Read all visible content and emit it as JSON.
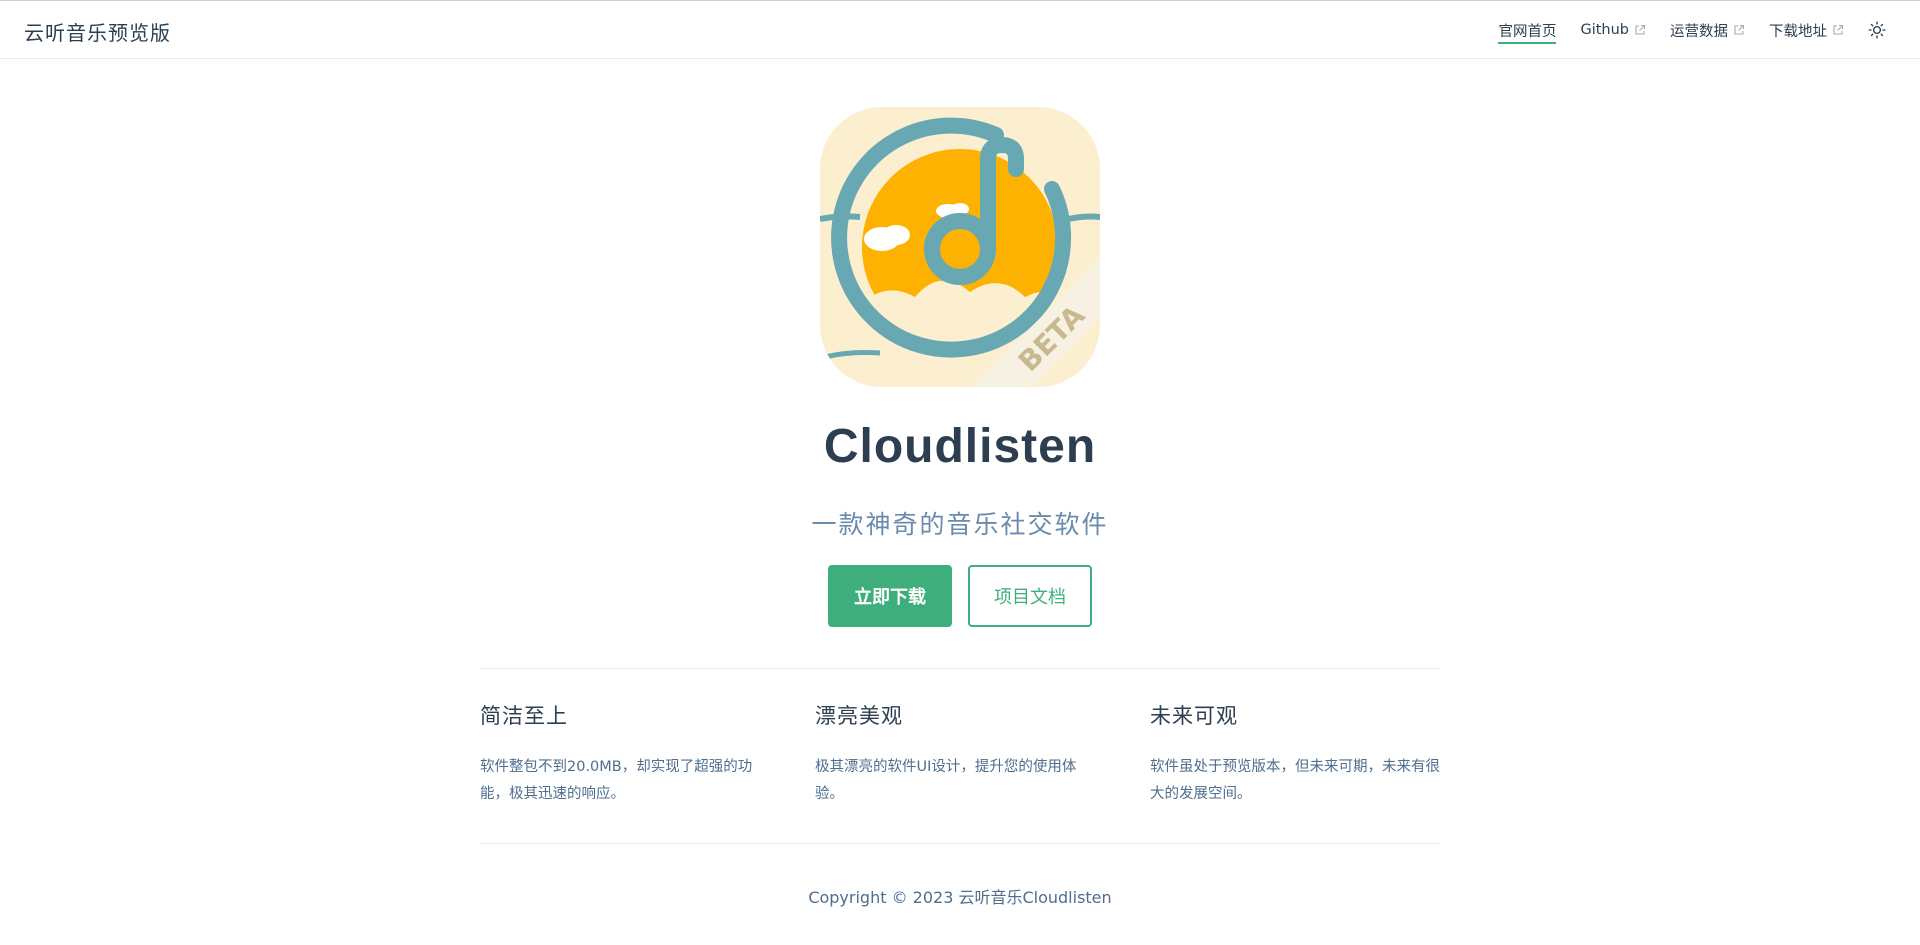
{
  "navbar": {
    "brand": "云听音乐预览版",
    "links": [
      {
        "label": "官网首页",
        "active": true,
        "external": false
      },
      {
        "label": "Github",
        "active": false,
        "external": true
      },
      {
        "label": "运营数据",
        "active": false,
        "external": true
      },
      {
        "label": "下载地址",
        "active": false,
        "external": true
      }
    ],
    "theme_toggle_icon": "sun-icon"
  },
  "hero": {
    "logo_badge": "BETA",
    "title": "Cloudlisten",
    "tagline": "一款神奇的音乐社交软件",
    "primary_action": "立即下载",
    "secondary_action": "项目文档"
  },
  "features": [
    {
      "title": "简洁至上",
      "details": "软件整包不到20.0MB，却实现了超强的功能，极其迅速的响应。"
    },
    {
      "title": "漂亮美观",
      "details": "极其漂亮的软件UI设计，提升您的使用体验。"
    },
    {
      "title": "未来可观",
      "details": "软件虽处于预览版本，但未来可期，未来有很大的发展空间。"
    }
  ],
  "footer": {
    "copyright": "Copyright © 2023 云听音乐Cloudlisten"
  },
  "colors": {
    "accent": "#3eaf7c",
    "text": "#2c3e50",
    "subtitle": "#6a8bad",
    "logo_teal": "#68a8b3",
    "logo_sun": "#fdb101",
    "logo_bg": "#fcefcf"
  }
}
